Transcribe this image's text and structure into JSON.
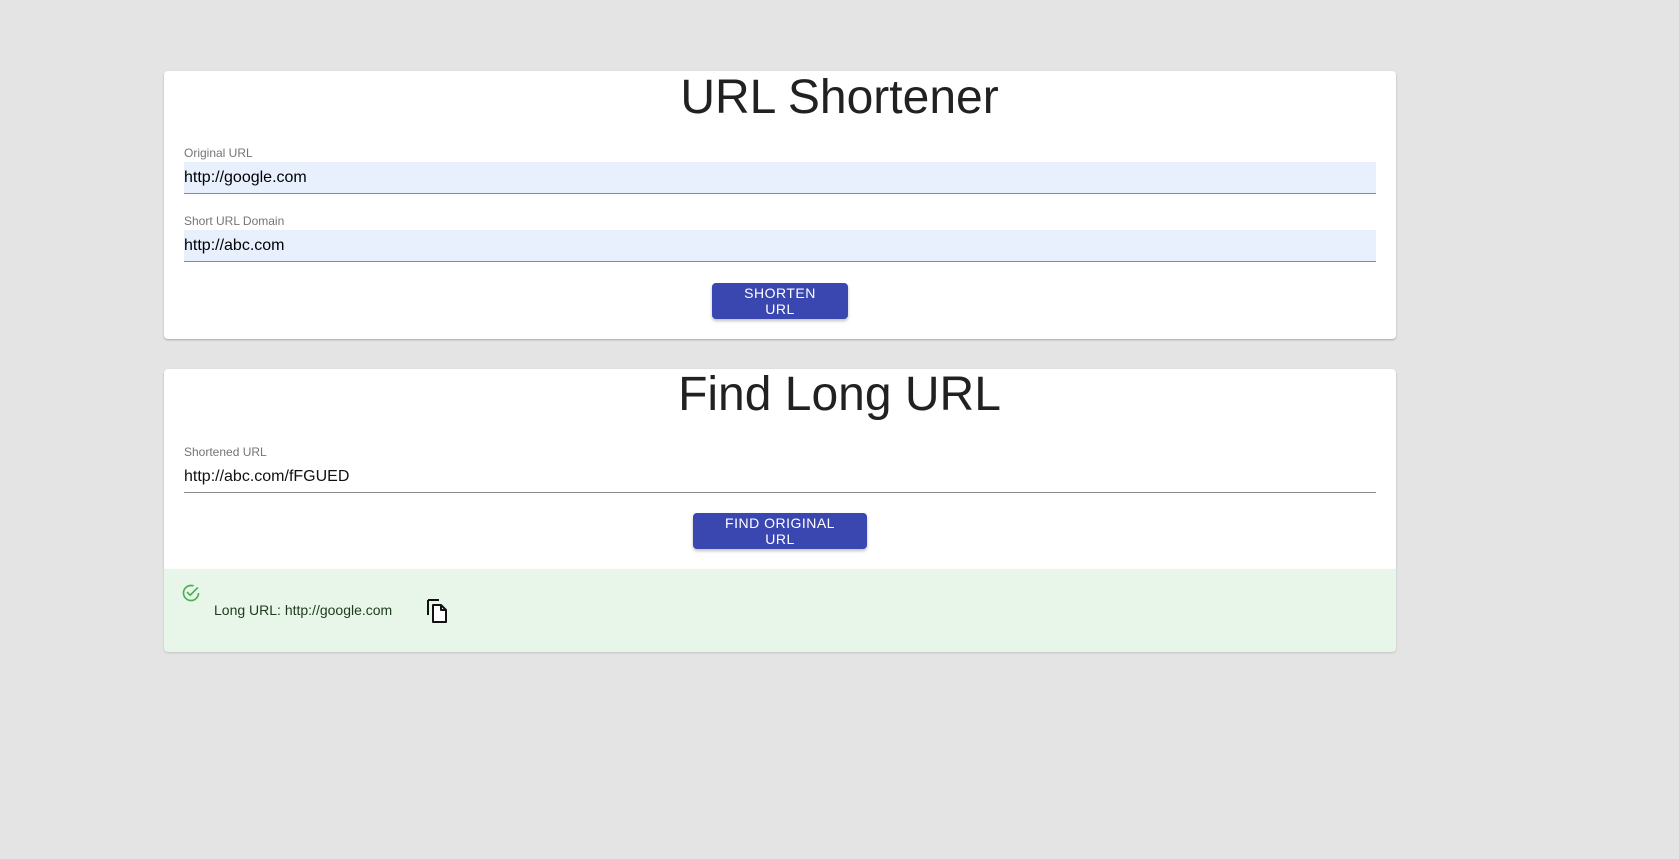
{
  "shorten_card": {
    "title": "URL Shortener",
    "original_url": {
      "label": "Original URL",
      "value": "http://google.com"
    },
    "short_domain": {
      "label": "Short URL Domain",
      "value": "http://abc.com"
    },
    "button_label": "Shorten URL"
  },
  "find_card": {
    "title": "Find Long URL",
    "shortened_url": {
      "label": "Shortened URL",
      "value": "http://abc.com/fFGUED"
    },
    "button_label": "Find Original URL"
  },
  "result": {
    "text": "Long URL: http://google.com",
    "status_icon": "check-circle-icon",
    "copy_icon": "copy-icon"
  },
  "colors": {
    "background": "#e4e4e4",
    "card": "#ffffff",
    "primary_button": "#3b47b0",
    "autofill": "#e8f0fe",
    "success_bg": "#e8f5e9",
    "success_icon": "#4caf50"
  }
}
